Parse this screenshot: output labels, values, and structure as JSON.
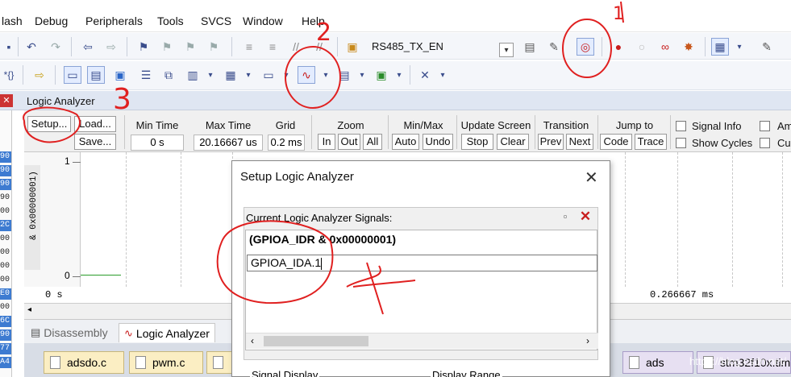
{
  "menu": {
    "items": [
      "lash",
      "Debug",
      "Peripherals",
      "Tools",
      "SVCS",
      "Window",
      "Help"
    ]
  },
  "toolbar": {
    "target_name": "RS485_TX_EN"
  },
  "logic_analyzer": {
    "title": "Logic Analyzer",
    "setup_label": "Setup...",
    "load_label": "Load...",
    "save_label": "Save...",
    "min_time_label": "Min Time",
    "min_time_value": "0 s",
    "max_time_label": "Max Time",
    "max_time_value": "20.16667 us",
    "grid_label": "Grid",
    "grid_value": "0.2 ms",
    "zoom_label": "Zoom",
    "zoom_in": "In",
    "zoom_out": "Out",
    "zoom_all": "All",
    "minmax_label": "Min/Max",
    "auto_label": "Auto",
    "undo_label": "Undo",
    "update_label": "Update Screen",
    "stop_label": "Stop",
    "clear_label": "Clear",
    "transition_label": "Transition",
    "prev_label": "Prev",
    "next_label": "Next",
    "jump_label": "Jump to",
    "code_label": "Code",
    "trace_label": "Trace",
    "signal_info_label": "Signal Info",
    "show_cycles_label": "Show Cycles",
    "amp_label": "Am",
    "cu_label": "Cu",
    "signal_name": "& 0x00000001)",
    "y_top": "1",
    "y_bottom": "0",
    "time_start": "0 s",
    "time_end": "0.266667 ms"
  },
  "address_strip": [
    "90",
    "90",
    "90",
    "90",
    "00",
    "2C",
    "00",
    "00",
    "00",
    "00",
    "E0",
    "00",
    "6C",
    "90",
    "77",
    "A4"
  ],
  "bottom_tabs": {
    "disassembly": "Disassembly",
    "logic_analyzer": "Logic Analyzer"
  },
  "file_tabs": [
    "adsdo.c",
    "pwm.c",
    "ads",
    "stm32f10x.tim"
  ],
  "dialog": {
    "title": "Setup Logic Analyzer",
    "list_label": "Current Logic Analyzer Signals:",
    "signal_1": "(GPIOA_IDR & 0x00000001)",
    "edit_value": "GPIOA_IDA.1",
    "signal_display_label": "Signal Display",
    "display_range_label": "Display Range"
  },
  "annotations": [
    "1",
    "2",
    "3",
    "4"
  ],
  "watermark": "https://blog.csdn.net/"
}
